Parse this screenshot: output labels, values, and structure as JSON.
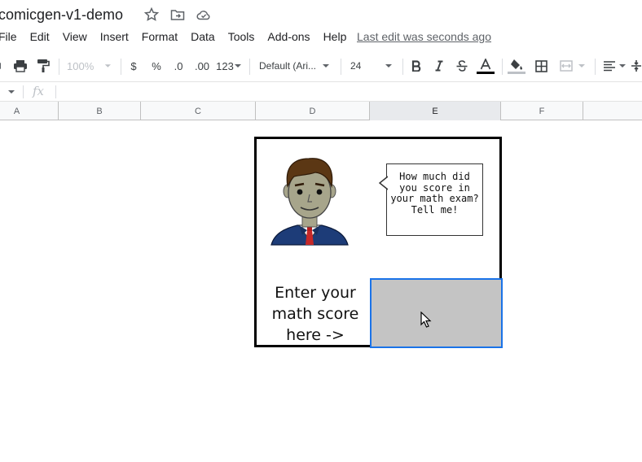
{
  "doc": {
    "title": "comicgen-v1-demo"
  },
  "menu": [
    "File",
    "Edit",
    "View",
    "Insert",
    "Format",
    "Data",
    "Tools",
    "Add-ons",
    "Help"
  ],
  "last_edit": "Last edit was seconds ago",
  "toolbar": {
    "zoom": "100%",
    "currency": "$",
    "percent": "%",
    "dec_decrease": ".0",
    "dec_increase": ".00",
    "more_formats": "123",
    "font": "Default (Ari...",
    "font_size": "24"
  },
  "formula_bar": {
    "fx": "fx"
  },
  "columns": [
    "A",
    "B",
    "C",
    "D",
    "E",
    "F"
  ],
  "comic": {
    "speech": "How much did you score in your math exam? Tell me!",
    "prompt": "Enter your math score here ->"
  }
}
